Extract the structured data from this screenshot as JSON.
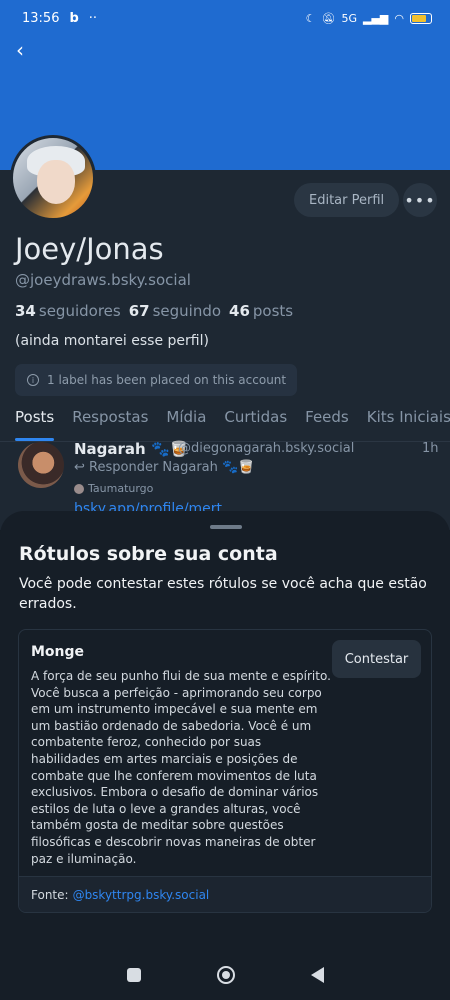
{
  "status_bar": {
    "time": "13:56",
    "app_icon": "b",
    "dots": "··",
    "network": "5G",
    "battery_text": ""
  },
  "profile": {
    "display_name": "Joey/Jonas",
    "handle": "@joeydraws.bsky.social",
    "followers_count": "34",
    "followers_label": "seguidores",
    "following_count": "67",
    "following_label": "seguindo",
    "posts_count": "46",
    "posts_label": "posts",
    "bio": "(ainda montarei esse perfil)",
    "label_notice": "1 label has been placed on this account",
    "edit_button": "Editar Perfil"
  },
  "tabs": [
    "Posts",
    "Respostas",
    "Mídia",
    "Curtidas",
    "Feeds",
    "Kits Iniciais"
  ],
  "post": {
    "author": "Nagarah 🐾🥃",
    "handle": "@diegonagarah.bsky.social",
    "time": "1h",
    "reply": "Responder Nagarah 🐾🥃",
    "tag": "Taumaturgo",
    "link": "bsky.app/profile/mert"
  },
  "sheet": {
    "title": "Rótulos sobre sua conta",
    "subtitle": "Você pode contestar estes rótulos se você acha que estão errados.",
    "card": {
      "label_name": "Monge",
      "description": "A força de seu punho flui de sua mente e espírito. Você busca a perfeição - aprimorando seu corpo em um instrumento impecável e sua mente em um bastião ordenado de sabedoria. Você é um combatente feroz, conhecido por suas habilidades em artes marciais e posições de combate que lhe conferem movimentos de luta exclusivos. Embora o desafio de dominar vários estilos de luta o leve a grandes alturas, você também gosta de meditar sobre questões filosóficas e descobrir novas maneiras de obter paz e iluminação.",
      "contest_button": "Contestar",
      "source_label": "Fonte:",
      "source_link": "@bskyttrpg.bsky.social"
    }
  },
  "colors": {
    "banner": "#1f6bd0",
    "accent": "#2f86f0",
    "background": "#161e27"
  }
}
